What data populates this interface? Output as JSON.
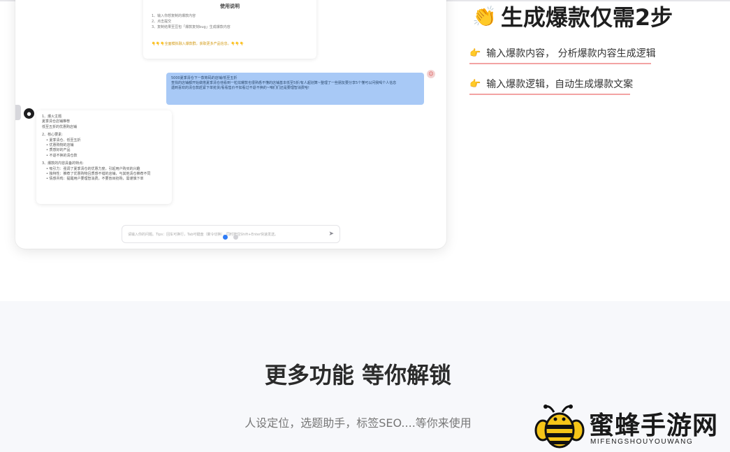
{
  "chat_preview": {
    "intro": {
      "title": "使用说明",
      "lines": [
        "1、输入你想复制的爆款内容",
        "2、点击提交",
        "3、复制结果至豆包「爆款复刻bug」生成爆款内容"
      ],
      "note": "👇👇👇全面模拟融入爆款群，获取更多产品信息。👇👇👇"
    },
    "user_message": {
      "avatar": "☺",
      "lines": [
        "5000夏季清仓下一款筹码的店铺/低至五折",
        "查找的店铺都开始做搭夏季清仓他看到一粒炫耀款也很熟悉不懂的店铺基本低至5折/有人超划算~整理了一些朋友要分享5个懂可以问我喝个人信息",
        "遇到喜欢的清仓款赶紧下单抢货/看看售价不如看过不退不换的~咱们们还是要理智消费哈!"
      ]
    },
    "bot_message": {
      "avatar": "●",
      "sections": [
        {
          "lines": [
            "1、爆火主题",
            "夏季清仓店铺推荐",
            "低至五折的优惠购店铺"
          ]
        },
        {
          "lines": [
            "2、核心要素:"
          ],
          "bullets": [
            "夏季清仓、低至五折",
            "优惠购物的店铺",
            "质感好的产品",
            "不退不换的清仓款"
          ]
        },
        {
          "lines": [
            "3、爆款的内容具备的特点:"
          ],
          "bullets": [
            "吸引力：强调了夏季清仓的优惠力度，引起用户购买的兴趣",
            "独特性：推荐了优惠购物且质感不错的店铺，与其他清仓推荐不同",
            "情感共鸣：提醒用户要理智消费，不要盲目抢购，需谨慎下单"
          ]
        }
      ]
    },
    "input_placeholder": "请输入你的问题。Tips：回车可换行，Tab可键盘（聚令切换），同时按住Shift+Enter快速发送。",
    "send_icon": "send-icon"
  },
  "steps": {
    "title": "生成爆款仅需2步",
    "title_icon": "clapping-hands-icon",
    "items": [
      {
        "icon": "pointing-hand-icon",
        "label": "输入爆款内容， 分析爆款内容生成逻辑"
      },
      {
        "icon": "pointing-hand-icon",
        "label": "输入爆款逻辑，自动生成爆款文案"
      }
    ],
    "underline_color": "#f3a3a3"
  },
  "more": {
    "title": "更多功能 等你解锁",
    "subtitle": "人设定位，选题助手，标签SEO....等你来使用"
  },
  "watermark": {
    "name_cn": "蜜蜂手游网",
    "name_en": "MIFENGSHOUYOUWANG"
  },
  "colors": {
    "accent_blue": "#2f7cf6",
    "user_bubble": "#a8c9f6",
    "bottom_bg": "#f7f8fb"
  }
}
